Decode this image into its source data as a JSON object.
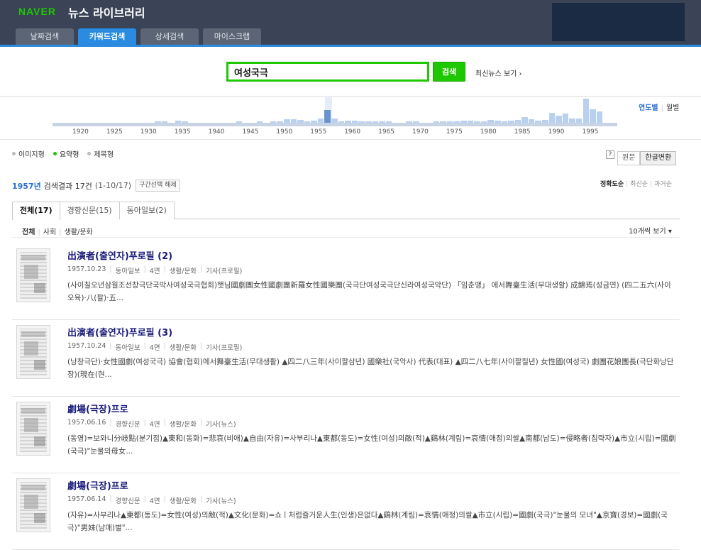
{
  "header": {
    "logo": "NAVER",
    "title": "뉴스 라이브러리",
    "tabs": [
      {
        "label": "날짜검색",
        "active": false
      },
      {
        "label": "키워드검색",
        "active": true
      },
      {
        "label": "상세검색",
        "active": false
      },
      {
        "label": "마이스크랩",
        "active": false
      }
    ]
  },
  "search": {
    "query": "여성국극",
    "button_label": "검색",
    "latest_news_link": "최신뉴스 보기 ›"
  },
  "timeline": {
    "mode_year": "연도별",
    "mode_month": "월별",
    "years": [
      "1920",
      "1925",
      "1930",
      "1935",
      "1940",
      "1945",
      "1950",
      "1955",
      "1960",
      "1965",
      "1970",
      "1975",
      "1980",
      "1985",
      "1990",
      "1995"
    ],
    "selected_year": "1957",
    "counts": [
      [
        1932,
        1
      ],
      [
        1933,
        2
      ],
      [
        1935,
        3
      ],
      [
        1936,
        1
      ],
      [
        1944,
        1
      ],
      [
        1947,
        1
      ],
      [
        1949,
        2
      ],
      [
        1950,
        2
      ],
      [
        1951,
        5
      ],
      [
        1952,
        5
      ],
      [
        1953,
        4
      ],
      [
        1954,
        2
      ],
      [
        1955,
        3
      ],
      [
        1956,
        6
      ],
      [
        1957,
        17
      ],
      [
        1958,
        6
      ],
      [
        1959,
        2
      ],
      [
        1960,
        3
      ],
      [
        1961,
        3
      ],
      [
        1962,
        2
      ],
      [
        1963,
        2
      ],
      [
        1964,
        2
      ],
      [
        1965,
        2
      ],
      [
        1966,
        1
      ],
      [
        1969,
        1
      ],
      [
        1970,
        1
      ],
      [
        1973,
        2
      ],
      [
        1974,
        2
      ],
      [
        1975,
        2
      ],
      [
        1976,
        1
      ],
      [
        1977,
        3
      ],
      [
        1978,
        3
      ],
      [
        1979,
        2
      ],
      [
        1980,
        2
      ],
      [
        1981,
        4
      ],
      [
        1982,
        3
      ],
      [
        1983,
        2
      ],
      [
        1984,
        3
      ],
      [
        1985,
        4
      ],
      [
        1986,
        8
      ],
      [
        1987,
        5
      ],
      [
        1988,
        3
      ],
      [
        1989,
        4
      ],
      [
        1990,
        14
      ],
      [
        1991,
        10
      ],
      [
        1992,
        13
      ],
      [
        1993,
        6
      ],
      [
        1994,
        6
      ],
      [
        1995,
        33
      ],
      [
        1996,
        18
      ],
      [
        1997,
        16
      ]
    ]
  },
  "view_options": [
    {
      "label": "이미지형",
      "on": false
    },
    {
      "label": "요약형",
      "on": true
    },
    {
      "label": "제목형",
      "on": false
    }
  ],
  "conversion": {
    "help": "?",
    "original": "원문",
    "hangul": "한글변환"
  },
  "summary": {
    "year": "1957년",
    "count": "검색결과 17건",
    "range": "(1-10/17)",
    "reset": "구간선택 해제"
  },
  "sort": {
    "accuracy": "정확도순",
    "latest": "최신순",
    "oldest": "과거순"
  },
  "source_tabs": [
    {
      "label": "전체(17)",
      "active": true
    },
    {
      "label": "경향신문(15)",
      "active": false
    },
    {
      "label": "동아일보(2)",
      "active": false
    }
  ],
  "categories": [
    {
      "label": "전체",
      "on": true
    },
    {
      "label": "사회",
      "on": false
    },
    {
      "label": "생활/문화",
      "on": false
    }
  ],
  "per_page": "10개씩 보기 ▾",
  "results": [
    {
      "title": "出演者(출연자)푸로필 (2)",
      "date": "1957.10.23",
      "paper": "동아일보",
      "page": "4면",
      "section": "생활/문화",
      "type": "기사(프로필)",
      "snippet": "(사이칠오년삼월조선창극단국악사여성국극협회)햇님國劇團女性國劇團新羅女性國樂團(국극단여성국극단신라여성국악단) 「임춘앵」 에서舞臺生活(무대생활) 成錦焉(성금연) (四二五六(사이오육)·八(팔)·五..."
    },
    {
      "title": "出演者(출연자)푸로필 (3)",
      "date": "1957.10.24",
      "paper": "동아일보",
      "page": "4면",
      "section": "생활/문화",
      "type": "기사(프로필)",
      "snippet": "(낭창극단)·女性國劇(여성국극) 協會(협회)에서舞臺生活(무대생활) ▲四二八三年(사이팔삼년) 國樂社(국악사) 代表(대표) ▲四二八七年(사이팔칠년) 女性國(여성국) 劇團花娘團長(극단화낭단장)(現在(현..."
    },
    {
      "title": "劇場(극장)프로",
      "date": "1957.06.16",
      "paper": "경향신문",
      "page": "4면",
      "section": "생활/문화",
      "type": "기사(뉴스)",
      "snippet": "(동영)=보와니分岐點(분기점)▲東和(동화)=悲哀(비애)▲自由(자유)=사부리나▲東都(동도)=女性(여성)의敵(적)▲鷄林(계림)=哀情(애정)의쌀▲南都(남도)=侵略者(침략자)▲市立(시립)=國劇(국극)\"눈물의母女..."
    },
    {
      "title": "劇場(극장)프로",
      "date": "1957.06.14",
      "paper": "경향신문",
      "page": "4면",
      "section": "생활/문화",
      "type": "기사(뉴스)",
      "snippet": "(자유)=사부리나▲東都(동도)=女性(여성)의敵(적)▲文化(문화)=쇼ㅣ처럼즐거운人生(인생)은없다▲鷄林(계림)=哀情(애정)의쌀▲市立(시립)=國劇(국극)\"눈물의 모녀\"▲京寶(경보)=國劇(국극)\"男妹(남매)별\"..."
    }
  ]
}
